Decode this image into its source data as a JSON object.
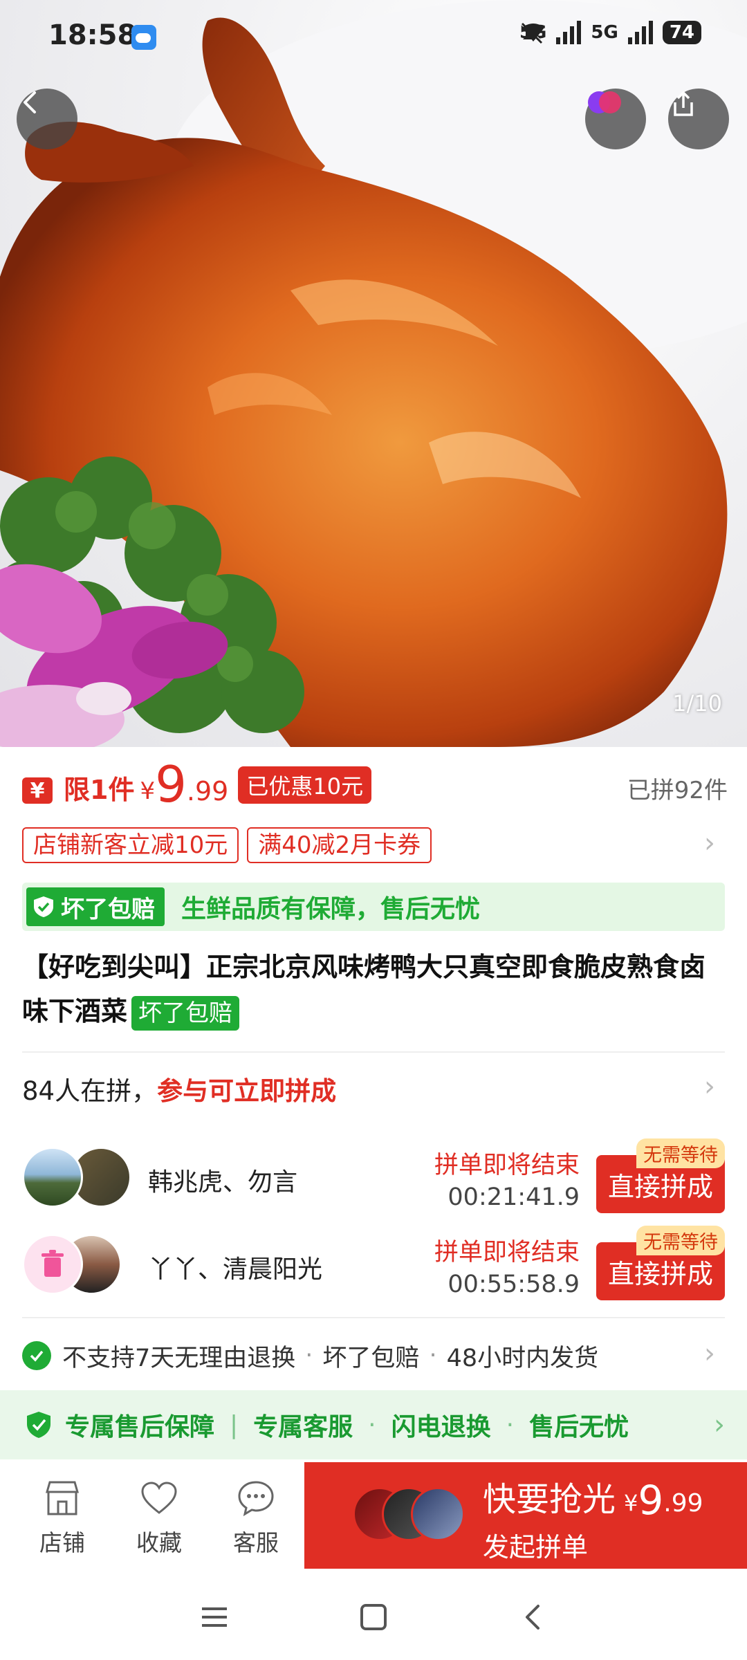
{
  "status_bar": {
    "time": "18:58",
    "network_1": "5G",
    "network_2": "5G",
    "battery": "74"
  },
  "gallery": {
    "page_indicator": "1/10"
  },
  "price": {
    "currency_icon": "¥",
    "limit_label": "限1件",
    "currency": "¥",
    "integer": "9",
    "decimal": ".99",
    "discount_tag": "已优惠10元",
    "sold_count": "已拼92件"
  },
  "coupons": [
    "店铺新客立减10元",
    "满40减2月卡券"
  ],
  "guarantee": {
    "badge": "坏了包赔",
    "text": "生鲜品质有保障，售后无忧"
  },
  "product": {
    "title": "【好吃到尖叫】正宗北京风味烤鸭大只真空即食脆皮熟食卤味下酒菜",
    "title_tag": "坏了包赔"
  },
  "group_buy": {
    "count_text": "84人在拼，",
    "highlight": "参与可立即拼成",
    "rows": [
      {
        "names": "韩兆虎、勿言",
        "ending_label": "拼单即将结束",
        "timer": "00:21:41.9",
        "button": "直接拼成",
        "tag": "无需等待"
      },
      {
        "names": "丫丫、清晨阳光",
        "ending_label": "拼单即将结束",
        "timer": "00:55:58.9",
        "button": "直接拼成",
        "tag": "无需等待"
      }
    ]
  },
  "service": {
    "items": [
      "不支持7天无理由退换",
      "坏了包赔",
      "48小时内发货"
    ],
    "separator": "·"
  },
  "after_sale": {
    "items": [
      "专属售后保障",
      "专属客服",
      "闪电退换",
      "售后无忧"
    ],
    "first_sep": "|",
    "separator": "·"
  },
  "bottom_bar": {
    "tabs": [
      {
        "label": "店铺",
        "icon": "store-icon"
      },
      {
        "label": "收藏",
        "icon": "heart-icon"
      },
      {
        "label": "客服",
        "icon": "chat-icon"
      }
    ],
    "cta": {
      "main": "快要抢光",
      "currency": "¥",
      "integer": "9",
      "decimal": ".99",
      "sub": "发起拼单"
    }
  },
  "colors": {
    "brand_red": "#e02e24",
    "guarantee_green": "#1fab35",
    "after_sale_bg": "#e9f7ea"
  }
}
